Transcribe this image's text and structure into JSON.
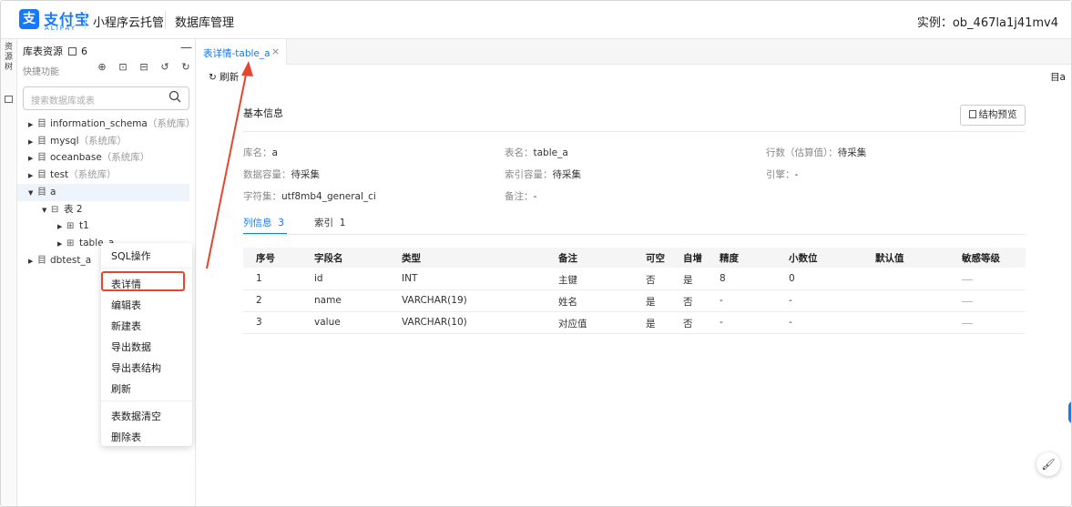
{
  "topbar": {
    "logo_glyph": "支",
    "brand_cn": "支付宝",
    "brand_en": "ALIPAY",
    "product": "小程序云托管",
    "section": "数据库管理",
    "instance": "实例：ob_467la1j41mv4"
  },
  "left_strip": {
    "tab_label": "资源树"
  },
  "sidebar": {
    "title": "库表资源",
    "count": "6",
    "minimize": "—",
    "quick_label": "快捷功能",
    "icons": [
      "add-circle-icon",
      "terminal-icon",
      "import-icon",
      "history-icon",
      "refresh-icon"
    ],
    "search_placeholder": "搜索数据库或表",
    "tree": [
      {
        "arrow": "▶",
        "icon": "目",
        "name": "information_schema",
        "tag": "（系统库）"
      },
      {
        "arrow": "▶",
        "icon": "目",
        "name": "mysql",
        "tag": "（系统库）"
      },
      {
        "arrow": "▶",
        "icon": "目",
        "name": "oceanbase",
        "tag": "（系统库）"
      },
      {
        "arrow": "▶",
        "icon": "目",
        "name": "test",
        "tag": "（系统库）"
      },
      {
        "arrow": "▼",
        "icon": "目",
        "name": "a",
        "tag": ""
      },
      {
        "arrow": "▼",
        "icon": "⊟",
        "name": "表 2",
        "tag": ""
      },
      {
        "arrow": "▶",
        "icon": "⊞",
        "name": "t1",
        "tag": ""
      },
      {
        "arrow": "▶",
        "icon": "⊞",
        "name": "table_a",
        "tag": ""
      },
      {
        "arrow": "▶",
        "icon": "目",
        "name": "dbtest_a",
        "tag": ""
      }
    ]
  },
  "context_menu": {
    "items": [
      "SQL操作",
      "表详情",
      "编辑表",
      "新建表",
      "导出数据",
      "导出表结构",
      "刷新",
      "表数据清空",
      "删除表"
    ],
    "highlighted": "表详情"
  },
  "tab": {
    "label": "表详情-table_a",
    "close": "×"
  },
  "toolbar": {
    "refresh": "刷新",
    "right_label": "目a"
  },
  "basic": {
    "title": "基本信息",
    "struct_button": "结构预览",
    "fields": [
      {
        "k": "库名：",
        "v": "a"
      },
      {
        "k": "表名：",
        "v": "table_a"
      },
      {
        "k": "行数（估算值）：",
        "v": "待采集"
      },
      {
        "k": "数据容量：",
        "v": "待采集"
      },
      {
        "k": "索引容量：",
        "v": "待采集"
      },
      {
        "k": "引擎：",
        "v": "-"
      },
      {
        "k": "字符集：",
        "v": "utf8mb4_general_ci"
      },
      {
        "k": "备注：",
        "v": "-"
      }
    ]
  },
  "subtabs": [
    {
      "label": "列信息",
      "count": "3"
    },
    {
      "label": "索引",
      "count": "1"
    }
  ],
  "table": {
    "headers": [
      "序号",
      "字段名",
      "类型",
      "备注",
      "可空",
      "自增",
      "精度",
      "小数位",
      "默认值",
      "敏感等级"
    ],
    "rows": [
      [
        "1",
        "id",
        "INT",
        "主键",
        "否",
        "是",
        "8",
        "0",
        "",
        ""
      ],
      [
        "2",
        "name",
        "VARCHAR(19)",
        "姓名",
        "是",
        "否",
        "-",
        "-",
        "",
        ""
      ],
      [
        "3",
        "value",
        "VARCHAR(10)",
        "对应值",
        "是",
        "否",
        "-",
        "-",
        "",
        ""
      ]
    ]
  },
  "floating": {
    "icon": "paint-roller-icon",
    "glyph": "🖌"
  },
  "colors": {
    "accent": "#1677ff",
    "annotation": "#e6452f"
  }
}
